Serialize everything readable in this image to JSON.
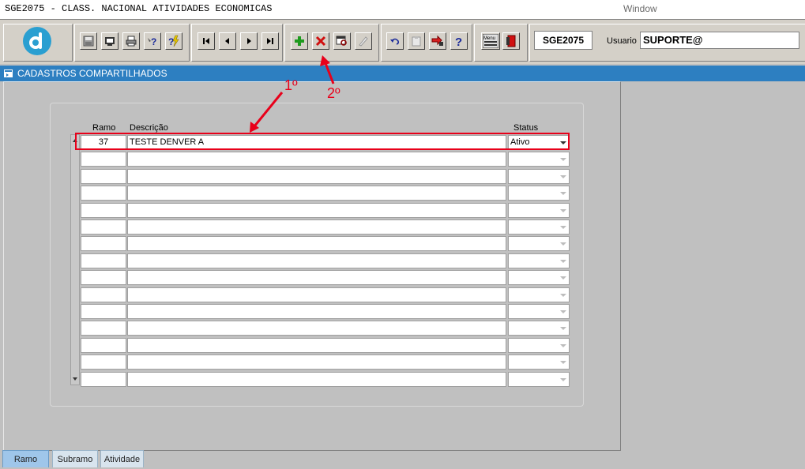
{
  "window": {
    "title": "SGE2075 - CLASS. NACIONAL ATIVIDADES ECONOMICAS",
    "menu_window": "Window"
  },
  "toolbar": {
    "groups": [
      [
        "save-icon",
        "screen-icon",
        "print-icon",
        "help-query-icon",
        "execute-query-icon"
      ],
      [
        "first-record-icon",
        "previous-record-icon",
        "next-record-icon",
        "last-record-icon"
      ],
      [
        "insert-record-icon",
        "delete-record-icon",
        "edit-record-icon",
        "disabled-tool-icon"
      ],
      [
        "undo-icon",
        "clipboard-icon",
        "tools-icon",
        "help-icon"
      ],
      [
        "menu-icon",
        "exit-icon"
      ]
    ],
    "form_code": "SGE2075",
    "user_label": "Usuario",
    "user_value": "SUPORTE@"
  },
  "section": {
    "title": "CADASTROS COMPARTILHADOS"
  },
  "table": {
    "headers": {
      "ramo": "Ramo",
      "descricao": "Descrição",
      "status": "Status"
    },
    "rows": [
      {
        "ramo": "37",
        "descricao": "TESTE DENVER A",
        "status": "Ativo"
      },
      {
        "ramo": "",
        "descricao": "",
        "status": ""
      },
      {
        "ramo": "",
        "descricao": "",
        "status": ""
      },
      {
        "ramo": "",
        "descricao": "",
        "status": ""
      },
      {
        "ramo": "",
        "descricao": "",
        "status": ""
      },
      {
        "ramo": "",
        "descricao": "",
        "status": ""
      },
      {
        "ramo": "",
        "descricao": "",
        "status": ""
      },
      {
        "ramo": "",
        "descricao": "",
        "status": ""
      },
      {
        "ramo": "",
        "descricao": "",
        "status": ""
      },
      {
        "ramo": "",
        "descricao": "",
        "status": ""
      },
      {
        "ramo": "",
        "descricao": "",
        "status": ""
      },
      {
        "ramo": "",
        "descricao": "",
        "status": ""
      },
      {
        "ramo": "",
        "descricao": "",
        "status": ""
      },
      {
        "ramo": "",
        "descricao": "",
        "status": ""
      },
      {
        "ramo": "",
        "descricao": "",
        "status": ""
      }
    ]
  },
  "annotations": {
    "first": "1º",
    "second": "2º",
    "color": "#e8001a"
  },
  "tabs": [
    {
      "label": "Ramo",
      "active": true
    },
    {
      "label": "Subramo",
      "active": false
    },
    {
      "label": "Atividade",
      "active": false
    }
  ],
  "colors": {
    "section_bar": "#2d7fc1",
    "logo": "#2a9fd1",
    "active_tab": "#9fc6ea"
  }
}
